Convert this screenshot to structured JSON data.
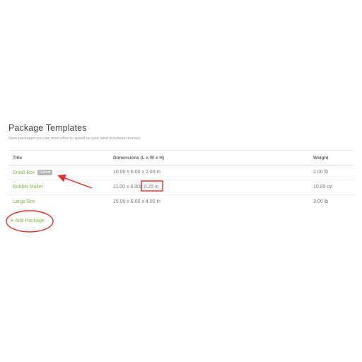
{
  "page": {
    "title": "Package Templates",
    "subtitle": "Save packages you use most often to speed up your label purchase process."
  },
  "table": {
    "headers": {
      "title": "Title",
      "dimensions": "Dimensions (L x W x H)",
      "weight": "Weight"
    },
    "rows": [
      {
        "title": "Small Box",
        "badge": "Default",
        "dimensions": "10.00 x 6.00 x 2.00 in",
        "weight": "2.00 lb"
      },
      {
        "title": "Bubble Mailer",
        "dimensions_main": "11.00 x 8.00",
        "dimensions_highlight": "x 0.25 in",
        "weight": "10.00 oz"
      },
      {
        "title": "Large Box",
        "dimensions": "15.00 x 8.00 x 4.00 in",
        "weight": "3.00 lb"
      }
    ]
  },
  "actions": {
    "add_icon": "plus-icon",
    "add_label": "Add Package"
  },
  "annotations": {
    "color": "#e52b2b"
  }
}
